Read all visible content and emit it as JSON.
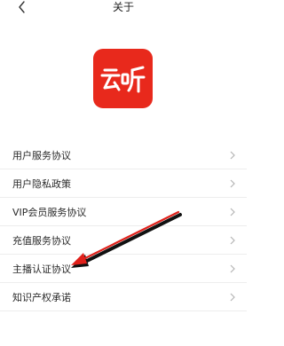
{
  "header": {
    "title": "关于",
    "back_icon": "chevron-left-icon"
  },
  "logo": {
    "text": "云听",
    "color": "#e8291c"
  },
  "menu": {
    "items": [
      {
        "label": "用户服务协议"
      },
      {
        "label": "用户隐私政策"
      },
      {
        "label": "VIP会员服务协议"
      },
      {
        "label": "充值服务协议"
      },
      {
        "label": "主播认证协议"
      },
      {
        "label": "知识产权承诺"
      }
    ],
    "chevron_icon": "chevron-right-icon"
  },
  "annotation": {
    "arrow_color": "#e0201a",
    "points_to": "主播认证协议"
  }
}
